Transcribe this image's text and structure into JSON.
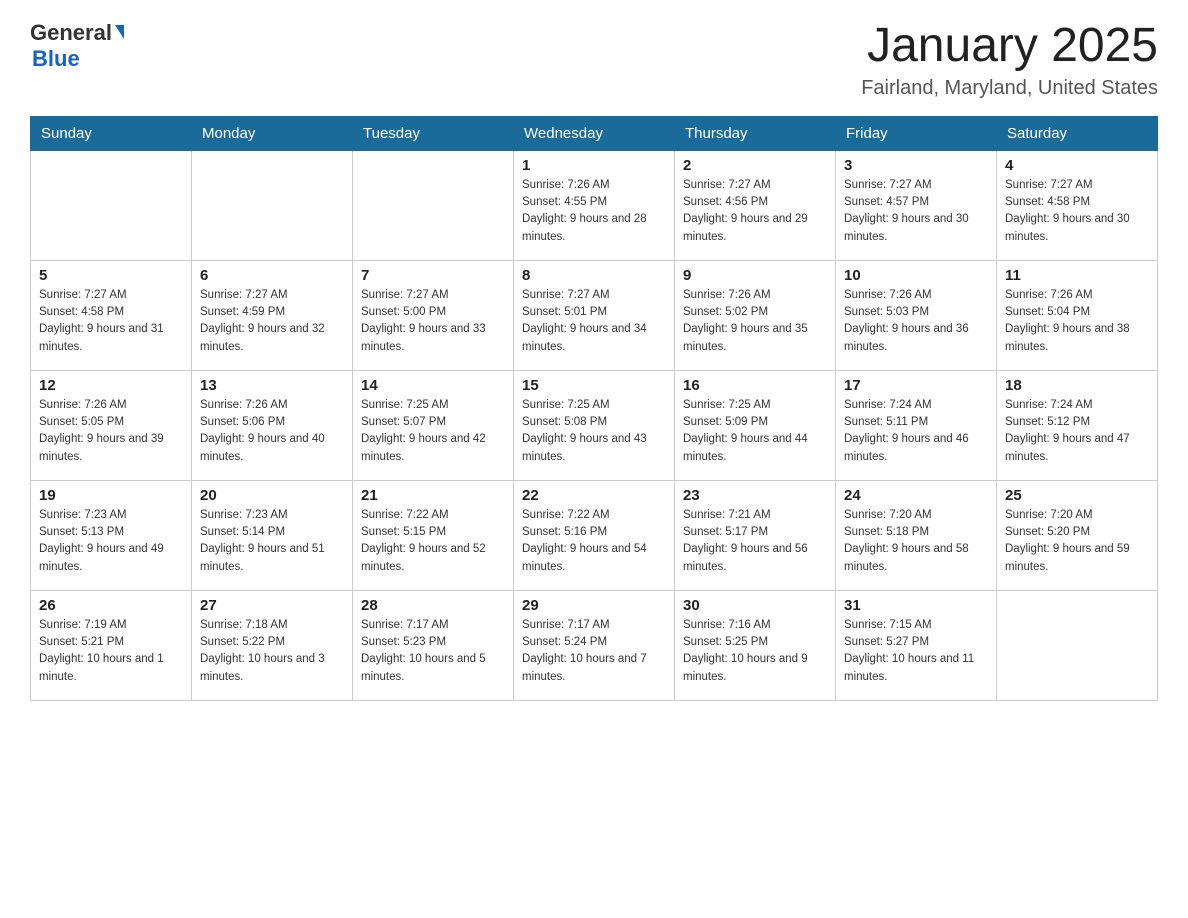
{
  "header": {
    "logo": {
      "general": "General",
      "blue": "Blue"
    },
    "title": "January 2025",
    "location": "Fairland, Maryland, United States"
  },
  "calendar": {
    "days_of_week": [
      "Sunday",
      "Monday",
      "Tuesday",
      "Wednesday",
      "Thursday",
      "Friday",
      "Saturday"
    ],
    "weeks": [
      [
        {
          "day": "",
          "info": ""
        },
        {
          "day": "",
          "info": ""
        },
        {
          "day": "",
          "info": ""
        },
        {
          "day": "1",
          "sunrise": "Sunrise: 7:26 AM",
          "sunset": "Sunset: 4:55 PM",
          "daylight": "Daylight: 9 hours and 28 minutes."
        },
        {
          "day": "2",
          "sunrise": "Sunrise: 7:27 AM",
          "sunset": "Sunset: 4:56 PM",
          "daylight": "Daylight: 9 hours and 29 minutes."
        },
        {
          "day": "3",
          "sunrise": "Sunrise: 7:27 AM",
          "sunset": "Sunset: 4:57 PM",
          "daylight": "Daylight: 9 hours and 30 minutes."
        },
        {
          "day": "4",
          "sunrise": "Sunrise: 7:27 AM",
          "sunset": "Sunset: 4:58 PM",
          "daylight": "Daylight: 9 hours and 30 minutes."
        }
      ],
      [
        {
          "day": "5",
          "sunrise": "Sunrise: 7:27 AM",
          "sunset": "Sunset: 4:58 PM",
          "daylight": "Daylight: 9 hours and 31 minutes."
        },
        {
          "day": "6",
          "sunrise": "Sunrise: 7:27 AM",
          "sunset": "Sunset: 4:59 PM",
          "daylight": "Daylight: 9 hours and 32 minutes."
        },
        {
          "day": "7",
          "sunrise": "Sunrise: 7:27 AM",
          "sunset": "Sunset: 5:00 PM",
          "daylight": "Daylight: 9 hours and 33 minutes."
        },
        {
          "day": "8",
          "sunrise": "Sunrise: 7:27 AM",
          "sunset": "Sunset: 5:01 PM",
          "daylight": "Daylight: 9 hours and 34 minutes."
        },
        {
          "day": "9",
          "sunrise": "Sunrise: 7:26 AM",
          "sunset": "Sunset: 5:02 PM",
          "daylight": "Daylight: 9 hours and 35 minutes."
        },
        {
          "day": "10",
          "sunrise": "Sunrise: 7:26 AM",
          "sunset": "Sunset: 5:03 PM",
          "daylight": "Daylight: 9 hours and 36 minutes."
        },
        {
          "day": "11",
          "sunrise": "Sunrise: 7:26 AM",
          "sunset": "Sunset: 5:04 PM",
          "daylight": "Daylight: 9 hours and 38 minutes."
        }
      ],
      [
        {
          "day": "12",
          "sunrise": "Sunrise: 7:26 AM",
          "sunset": "Sunset: 5:05 PM",
          "daylight": "Daylight: 9 hours and 39 minutes."
        },
        {
          "day": "13",
          "sunrise": "Sunrise: 7:26 AM",
          "sunset": "Sunset: 5:06 PM",
          "daylight": "Daylight: 9 hours and 40 minutes."
        },
        {
          "day": "14",
          "sunrise": "Sunrise: 7:25 AM",
          "sunset": "Sunset: 5:07 PM",
          "daylight": "Daylight: 9 hours and 42 minutes."
        },
        {
          "day": "15",
          "sunrise": "Sunrise: 7:25 AM",
          "sunset": "Sunset: 5:08 PM",
          "daylight": "Daylight: 9 hours and 43 minutes."
        },
        {
          "day": "16",
          "sunrise": "Sunrise: 7:25 AM",
          "sunset": "Sunset: 5:09 PM",
          "daylight": "Daylight: 9 hours and 44 minutes."
        },
        {
          "day": "17",
          "sunrise": "Sunrise: 7:24 AM",
          "sunset": "Sunset: 5:11 PM",
          "daylight": "Daylight: 9 hours and 46 minutes."
        },
        {
          "day": "18",
          "sunrise": "Sunrise: 7:24 AM",
          "sunset": "Sunset: 5:12 PM",
          "daylight": "Daylight: 9 hours and 47 minutes."
        }
      ],
      [
        {
          "day": "19",
          "sunrise": "Sunrise: 7:23 AM",
          "sunset": "Sunset: 5:13 PM",
          "daylight": "Daylight: 9 hours and 49 minutes."
        },
        {
          "day": "20",
          "sunrise": "Sunrise: 7:23 AM",
          "sunset": "Sunset: 5:14 PM",
          "daylight": "Daylight: 9 hours and 51 minutes."
        },
        {
          "day": "21",
          "sunrise": "Sunrise: 7:22 AM",
          "sunset": "Sunset: 5:15 PM",
          "daylight": "Daylight: 9 hours and 52 minutes."
        },
        {
          "day": "22",
          "sunrise": "Sunrise: 7:22 AM",
          "sunset": "Sunset: 5:16 PM",
          "daylight": "Daylight: 9 hours and 54 minutes."
        },
        {
          "day": "23",
          "sunrise": "Sunrise: 7:21 AM",
          "sunset": "Sunset: 5:17 PM",
          "daylight": "Daylight: 9 hours and 56 minutes."
        },
        {
          "day": "24",
          "sunrise": "Sunrise: 7:20 AM",
          "sunset": "Sunset: 5:18 PM",
          "daylight": "Daylight: 9 hours and 58 minutes."
        },
        {
          "day": "25",
          "sunrise": "Sunrise: 7:20 AM",
          "sunset": "Sunset: 5:20 PM",
          "daylight": "Daylight: 9 hours and 59 minutes."
        }
      ],
      [
        {
          "day": "26",
          "sunrise": "Sunrise: 7:19 AM",
          "sunset": "Sunset: 5:21 PM",
          "daylight": "Daylight: 10 hours and 1 minute."
        },
        {
          "day": "27",
          "sunrise": "Sunrise: 7:18 AM",
          "sunset": "Sunset: 5:22 PM",
          "daylight": "Daylight: 10 hours and 3 minutes."
        },
        {
          "day": "28",
          "sunrise": "Sunrise: 7:17 AM",
          "sunset": "Sunset: 5:23 PM",
          "daylight": "Daylight: 10 hours and 5 minutes."
        },
        {
          "day": "29",
          "sunrise": "Sunrise: 7:17 AM",
          "sunset": "Sunset: 5:24 PM",
          "daylight": "Daylight: 10 hours and 7 minutes."
        },
        {
          "day": "30",
          "sunrise": "Sunrise: 7:16 AM",
          "sunset": "Sunset: 5:25 PM",
          "daylight": "Daylight: 10 hours and 9 minutes."
        },
        {
          "day": "31",
          "sunrise": "Sunrise: 7:15 AM",
          "sunset": "Sunset: 5:27 PM",
          "daylight": "Daylight: 10 hours and 11 minutes."
        },
        {
          "day": "",
          "info": ""
        }
      ]
    ]
  }
}
